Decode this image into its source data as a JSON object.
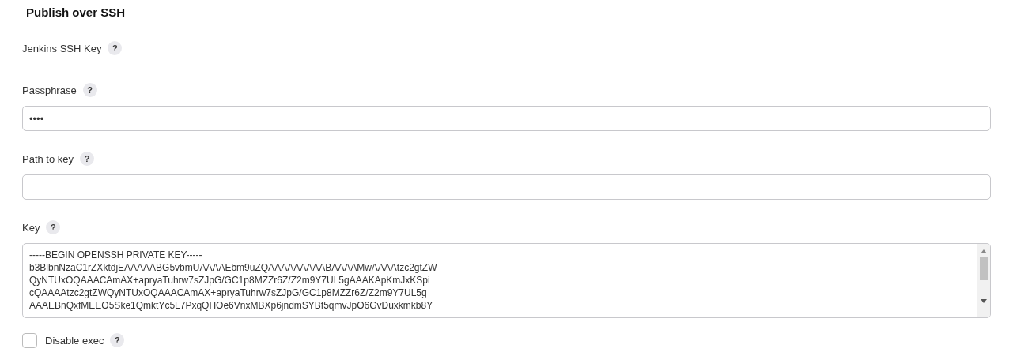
{
  "title": "Publish over SSH",
  "fields": [
    {
      "kind": "label",
      "label": "Jenkins SSH Key",
      "help": "?"
    },
    {
      "kind": "password",
      "label": "Passphrase",
      "help": "?",
      "value": "••••"
    },
    {
      "kind": "text",
      "label": "Path to key",
      "help": "?"
    },
    {
      "kind": "textarea",
      "label": "Key",
      "help": "?",
      "lines": [
        "-----BEGIN OPENSSH PRIVATE KEY-----",
        "b3BlbnNzaC1rZXktdjEAAAAABG5vbmUAAAAEbm9uZQAAAAAAAAABAAAAMwAAAAtzc2gtZW",
        "QyNTUxOQAAACAmAX+apryaTuhrw7sZJpG/GC1p8MZZr6Z/Z2m9Y7UL5gAAAKApKmJxKSpi",
        "cQAAAAtzc2gtZWQyNTUxOQAAACAmAX+apryaTuhrw7sZJpG/GC1p8MZZr6Z/Z2m9Y7UL5g",
        "AAAEBnQxfMEEO5Ske1QmktYc5L7PxqQHOe6VnxMBXp6jndmSYBf5qmvJpO6GvDuxkmkb8Y"
      ]
    },
    {
      "kind": "checkbox",
      "label": "Disable exec",
      "help": "?",
      "checked": false
    }
  ]
}
